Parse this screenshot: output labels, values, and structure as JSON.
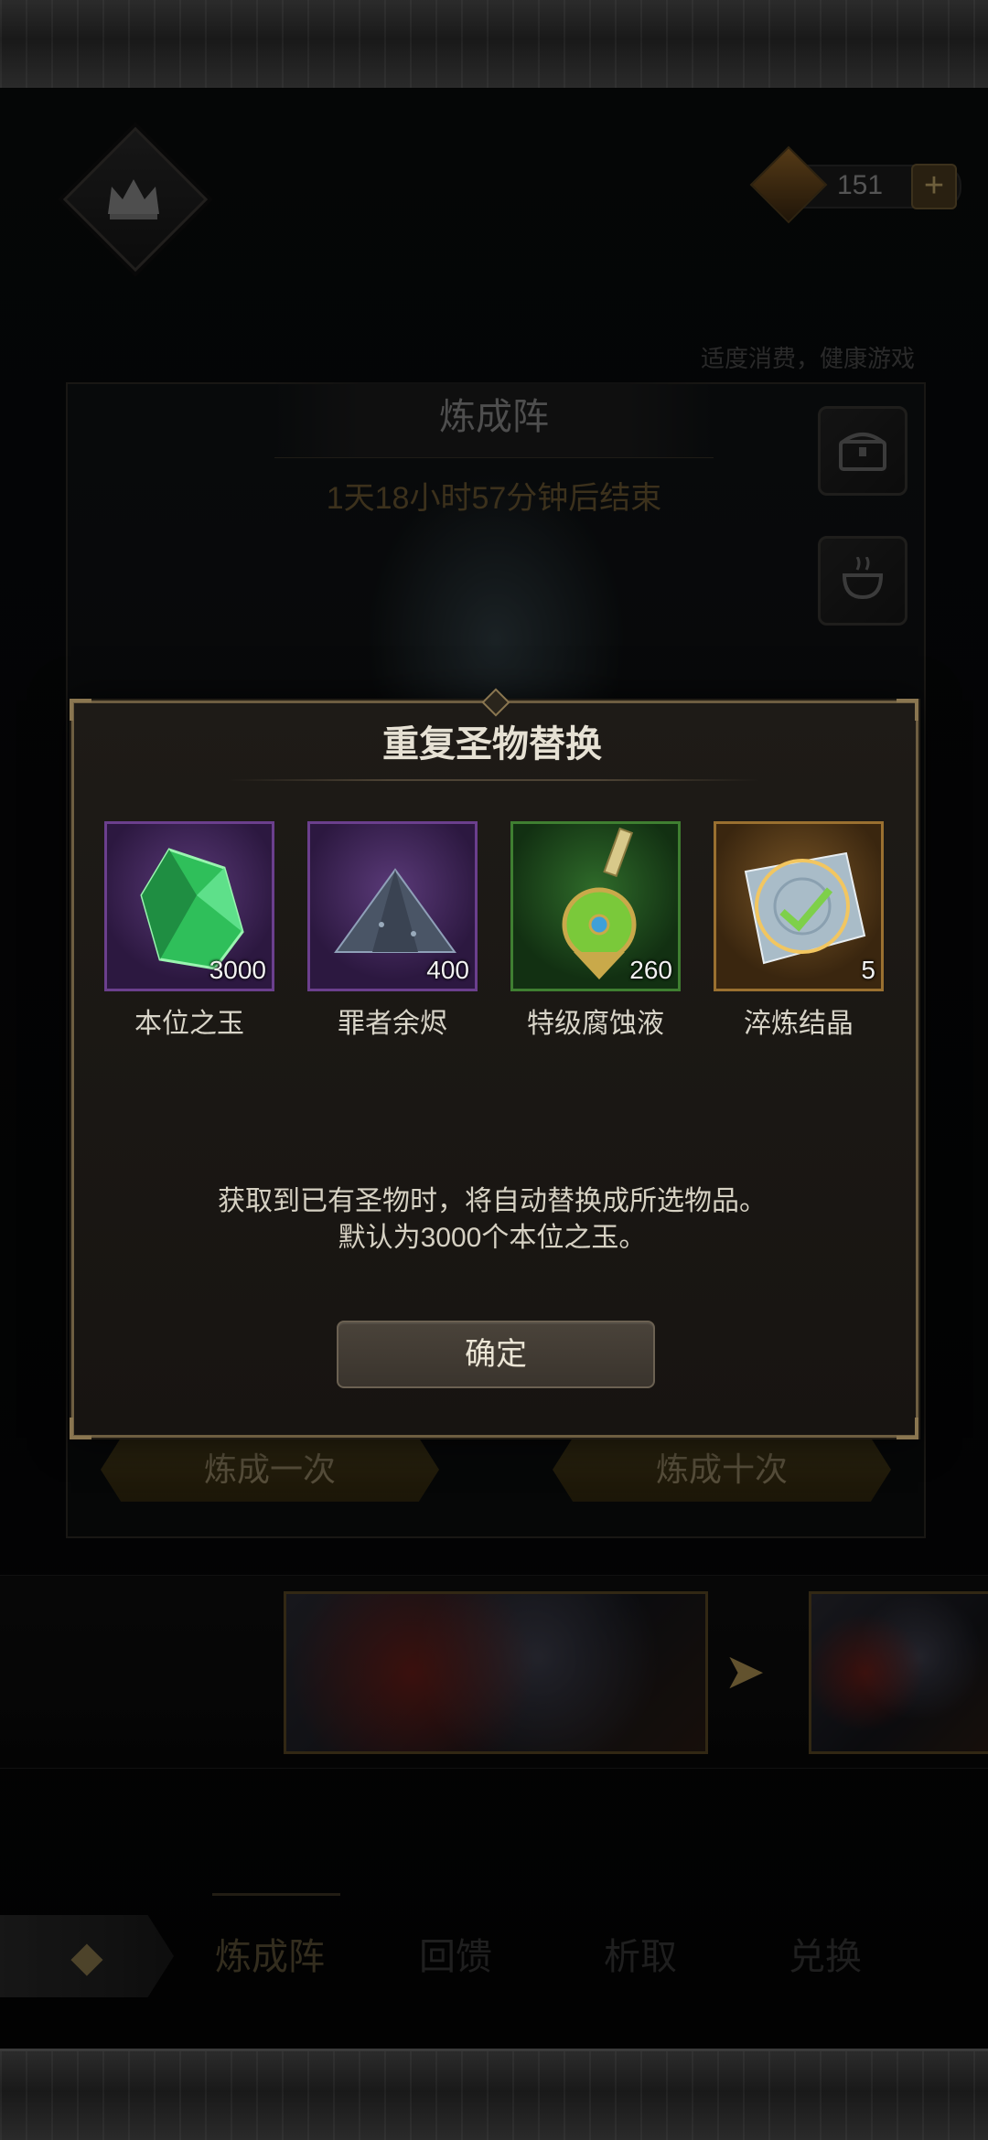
{
  "header": {
    "currency_value": "151",
    "plus_label": "+",
    "notice": "适度消费，健康游戏"
  },
  "panel": {
    "title": "炼成阵",
    "timer": "1天18小时57分钟后结束"
  },
  "buttons": {
    "refine_once": "炼成一次",
    "refine_ten": "炼成十次"
  },
  "nav": {
    "tabs": [
      {
        "label": "炼成阵",
        "active": true
      },
      {
        "label": "回馈",
        "active": false
      },
      {
        "label": "析取",
        "active": false
      },
      {
        "label": "兑换",
        "active": false
      }
    ]
  },
  "modal": {
    "title": "重复圣物替换",
    "items": [
      {
        "name": "本位之玉",
        "qty": "3000",
        "rarity": "purple",
        "icon": "green-gem-icon"
      },
      {
        "name": "罪者余烬",
        "qty": "400",
        "rarity": "purple",
        "icon": "ash-pile-icon"
      },
      {
        "name": "特级腐蚀液",
        "qty": "260",
        "rarity": "green",
        "icon": "potion-vial-icon"
      },
      {
        "name": "淬炼结晶",
        "qty": "5",
        "rarity": "gold",
        "icon": "crystal-rune-icon"
      }
    ],
    "description_line1": "获取到已有圣物时，将自动替换成所选物品。",
    "description_line2": "默认为3000个本位之玉。",
    "confirm_label": "确定"
  },
  "colors": {
    "accent_gold": "#8a7650",
    "rarity_purple": "#6b3f8d",
    "rarity_green": "#3f7f31",
    "rarity_gold": "#9a7030"
  }
}
